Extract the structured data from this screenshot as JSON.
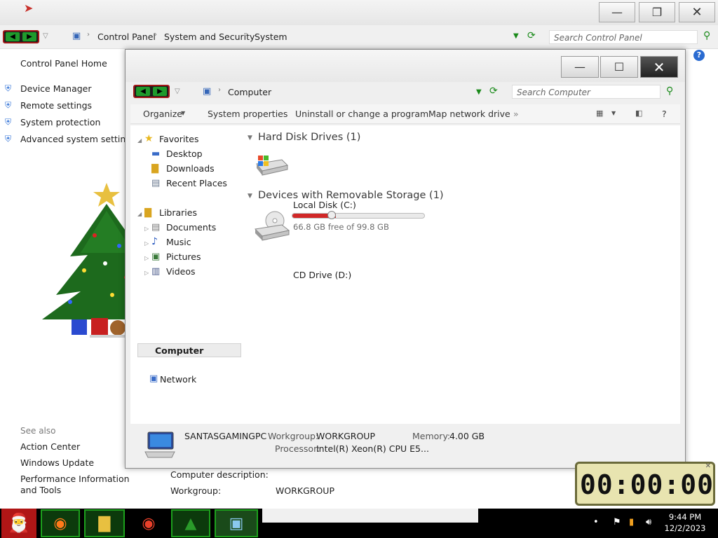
{
  "control_panel": {
    "breadcrumb": [
      "Control Panel",
      "System and Security",
      "System"
    ],
    "search_placeholder": "Search Control Panel",
    "left_links": {
      "home": "Control Panel Home",
      "tasks": [
        "Device Manager",
        "Remote settings",
        "System protection",
        "Advanced system settings"
      ],
      "see_also_title": "See also",
      "see_also": [
        "Action Center",
        "Windows Update",
        "Performance Information and Tools"
      ]
    },
    "computer_description_label": "Computer description:",
    "workgroup_label": "Workgroup:",
    "workgroup_value": "WORKGROUP"
  },
  "computer_window": {
    "address": "Computer",
    "search_placeholder": "Search Computer",
    "toolbar": {
      "organize": "Organize",
      "system_properties": "System properties",
      "uninstall": "Uninstall or change a program",
      "map_drive": "Map network drive",
      "more": "»",
      "help": "?"
    },
    "nav": {
      "favorites": "Favorites",
      "favorites_items": [
        "Desktop",
        "Downloads",
        "Recent Places"
      ],
      "libraries": "Libraries",
      "library_items": [
        "Documents",
        "Music",
        "Pictures",
        "Videos"
      ],
      "computer": "Computer",
      "network": "Network"
    },
    "groups": {
      "hdd_header": "Hard Disk Drives (1)",
      "removable_header": "Devices with Removable Storage (1)"
    },
    "drives": {
      "local_name": "Local Disk (C:)",
      "local_free": "66.8 GB free of 99.8 GB",
      "used_fraction": 0.331,
      "cd_name": "CD Drive (D:)"
    },
    "details": {
      "computer_name": "SANTASGAMINGPC",
      "workgroup_label": "Workgroup:",
      "workgroup_value": "WORKGROUP",
      "memory_label": "Memory:",
      "memory_value": "4.00 GB",
      "processor_label": "Processor:",
      "processor_value": "Intel(R) Xeon(R) CPU E5..."
    }
  },
  "clock": {
    "display": "00:00:00"
  },
  "taskbar": {
    "time": "9:44 PM",
    "date": "12/2/2023"
  },
  "colors": {
    "drive_bar": "#d12828",
    "nav_arrow_green": "#1f9a2c",
    "taskbar": "#000000"
  }
}
